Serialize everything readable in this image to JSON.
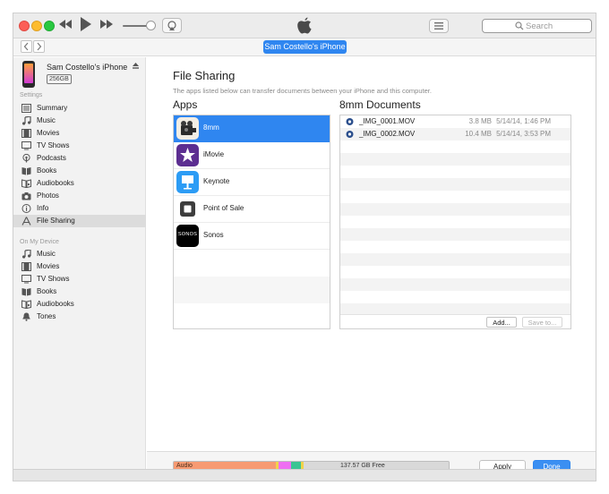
{
  "colors": {
    "accent": "#2f86f0",
    "audio": "#f79a72",
    "purple": "#ee6ef2",
    "green": "#3bc493",
    "yellow": "#f1d34a",
    "free": "#d9d9d9"
  },
  "toolbar": {
    "search_placeholder": "Search",
    "icons": [
      "rewind-icon",
      "play-icon",
      "fast-forward-icon",
      "airplay-icon",
      "apple-logo-icon",
      "list-view-icon",
      "search-icon"
    ]
  },
  "nav": {
    "device_pill": "Sam Costello's iPhone"
  },
  "sidebar": {
    "device_name": "Sam Costello's iPhone",
    "device_capacity": "256GB",
    "settings_header": "Settings",
    "settings_items": [
      {
        "label": "Summary",
        "icon": "summary-icon"
      },
      {
        "label": "Music",
        "icon": "music-note-icon"
      },
      {
        "label": "Movies",
        "icon": "film-icon"
      },
      {
        "label": "TV Shows",
        "icon": "tv-icon"
      },
      {
        "label": "Podcasts",
        "icon": "podcast-icon"
      },
      {
        "label": "Books",
        "icon": "book-icon"
      },
      {
        "label": "Audiobooks",
        "icon": "audiobook-icon"
      },
      {
        "label": "Photos",
        "icon": "camera-icon"
      },
      {
        "label": "Info",
        "icon": "info-icon"
      },
      {
        "label": "File Sharing",
        "icon": "file-sharing-icon"
      }
    ],
    "device_header": "On My Device",
    "device_items": [
      {
        "label": "Music",
        "icon": "music-note-icon"
      },
      {
        "label": "Movies",
        "icon": "film-icon"
      },
      {
        "label": "TV Shows",
        "icon": "tv-icon"
      },
      {
        "label": "Books",
        "icon": "book-icon"
      },
      {
        "label": "Audiobooks",
        "icon": "audiobook-icon"
      },
      {
        "label": "Tones",
        "icon": "bell-icon"
      }
    ]
  },
  "main": {
    "title": "File Sharing",
    "description": "The apps listed below can transfer documents between your iPhone and this computer.",
    "apps_header": "Apps",
    "docs_header": "8mm Documents",
    "apps": [
      {
        "name": "8mm",
        "icon": "8mm-app-icon"
      },
      {
        "name": "iMovie",
        "icon": "imovie-app-icon"
      },
      {
        "name": "Keynote",
        "icon": "keynote-app-icon"
      },
      {
        "name": "Point of Sale",
        "icon": "point-of-sale-app-icon"
      },
      {
        "name": "Sonos",
        "icon": "sonos-app-icon",
        "logo_text": "SONOS"
      }
    ],
    "documents": [
      {
        "name": "_IMG_0001.MOV",
        "size": "3.8 MB",
        "date": "5/14/14, 1:46 PM"
      },
      {
        "name": "_IMG_0002.MOV",
        "size": "10.4 MB",
        "date": "5/14/14, 3:53 PM"
      }
    ],
    "add_button": "Add...",
    "save_button": "Save to..."
  },
  "footer": {
    "audio_label": "Audio",
    "free_label": "137.57 GB Free",
    "apply_button": "Apply",
    "done_button": "Done"
  }
}
